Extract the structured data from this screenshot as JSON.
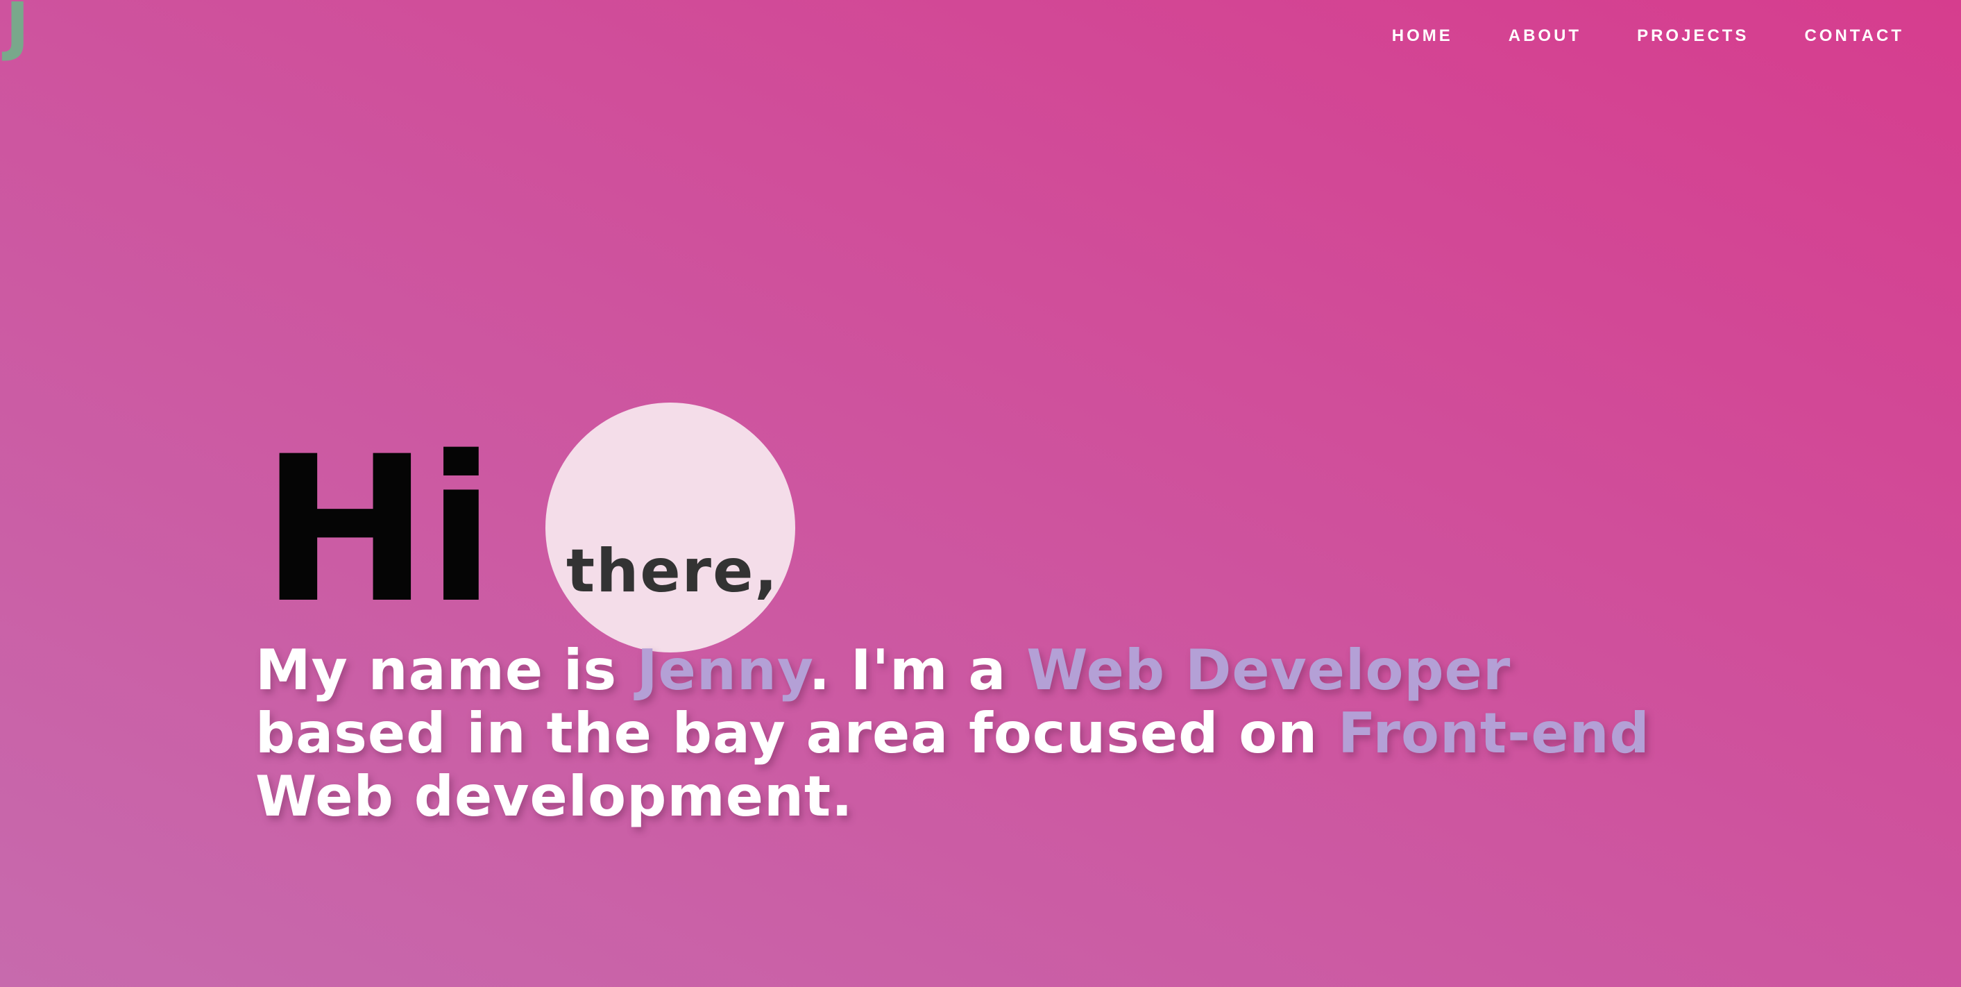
{
  "logo": {
    "letter": "J",
    "color": "#79a88b"
  },
  "nav": {
    "items": [
      {
        "label": "HOME"
      },
      {
        "label": "ABOUT"
      },
      {
        "label": "PROJECTS"
      },
      {
        "label": "CONTACT"
      }
    ]
  },
  "hero": {
    "hi": "Hi",
    "there": "there,",
    "intro": {
      "part1": "My name is ",
      "name": "Jenny",
      "part2": ". I'm a ",
      "role": "Web Developer",
      "part3": " based in the bay area focused on ",
      "focus": "Front-end",
      "part4": " Web development."
    }
  },
  "colors": {
    "background_start": "#c76aad",
    "background_end": "#d63d8e",
    "accent": "#b4a0d6",
    "circle": "#f4dde9",
    "text": "#ffffff"
  }
}
